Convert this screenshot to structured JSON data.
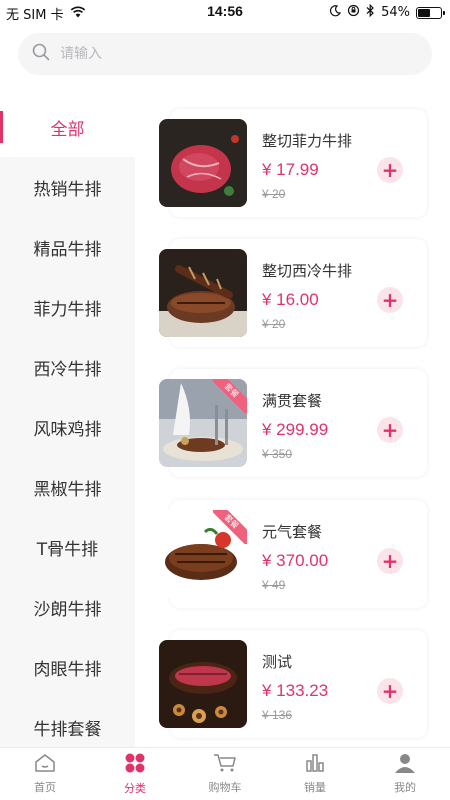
{
  "status_bar": {
    "carrier": "无 SIM 卡",
    "time": "14:56",
    "battery": "54%",
    "battery_level": 0.54
  },
  "search": {
    "placeholder": "请输入"
  },
  "categories": [
    {
      "label": "全部",
      "active": true
    },
    {
      "label": "热销牛排"
    },
    {
      "label": "精品牛排"
    },
    {
      "label": "菲力牛排"
    },
    {
      "label": "西冷牛排"
    },
    {
      "label": "风味鸡排"
    },
    {
      "label": "黑椒牛排"
    },
    {
      "label": "T骨牛排"
    },
    {
      "label": "沙朗牛排"
    },
    {
      "label": "肉眼牛排"
    },
    {
      "label": "牛排套餐"
    }
  ],
  "products": [
    {
      "name": "整切菲力牛排",
      "price": "¥ 17.99",
      "original_price": "¥ 20",
      "badge": ""
    },
    {
      "name": "整切西冷牛排",
      "price": "¥ 16.00",
      "original_price": "¥ 20",
      "badge": ""
    },
    {
      "name": "满贯套餐",
      "price": "¥ 299.99",
      "original_price": "¥ 350",
      "badge": "套餐"
    },
    {
      "name": "元气套餐",
      "price": "¥ 370.00",
      "original_price": "¥ 49",
      "badge": "套餐"
    },
    {
      "name": "测试",
      "price": "¥ 133.23",
      "original_price": "¥ 136",
      "badge": ""
    }
  ],
  "tabbar": [
    {
      "label": "首页",
      "icon": "home-icon"
    },
    {
      "label": "分类",
      "icon": "category-icon",
      "active": true
    },
    {
      "label": "购物车",
      "icon": "cart-icon"
    },
    {
      "label": "销量",
      "icon": "sales-chart-icon"
    },
    {
      "label": "我的",
      "icon": "profile-icon"
    }
  ],
  "colors": {
    "accent": "#e0336a",
    "accent_light": "#fbe3ea",
    "sidebar_bg": "#f7f7f7"
  }
}
